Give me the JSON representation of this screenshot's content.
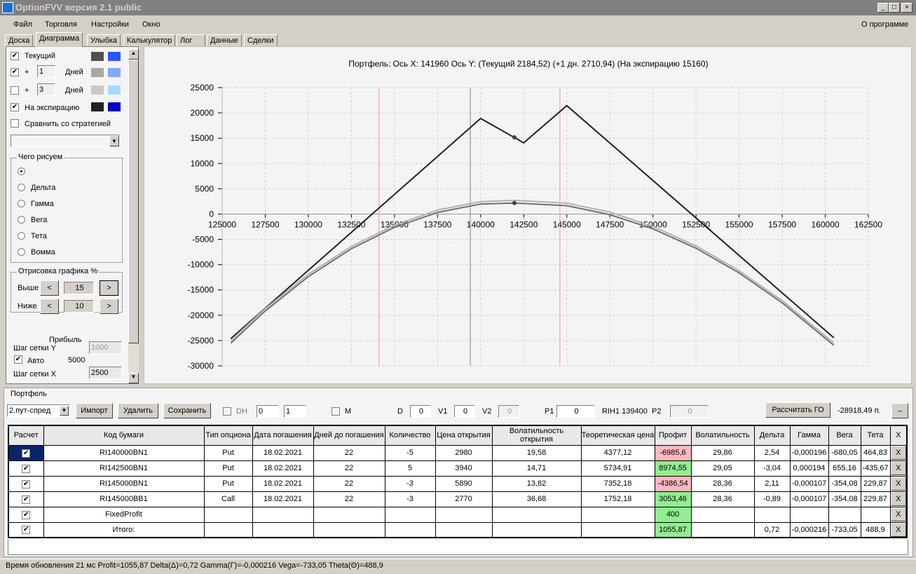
{
  "window": {
    "title": "OptionFVV версия 2.1 public",
    "minimize": "_",
    "maximize": "□",
    "close": "×"
  },
  "menu": [
    "Файл",
    "Торговля",
    "Настройки",
    "Окно"
  ],
  "about": "О программе",
  "tabs": [
    "Доска",
    "Диаграмма",
    "Улыбка",
    "Калькулятор",
    "Лог",
    "Данные",
    "Сделки"
  ],
  "left": {
    "current": "Текущий",
    "plus": "+",
    "days": "Дней",
    "days1": "1",
    "days3": "3",
    "expiration": "На экспирацию",
    "compare": "Сравнить со стратегией",
    "colors": {
      "cur": [
        "#505050",
        "#2a55ff"
      ],
      "d1": [
        "#a8a8a8",
        "#7faaff"
      ],
      "d3": [
        "#c8c8c8",
        "#aad8ff"
      ],
      "exp": [
        "#202020",
        "#0000c8"
      ]
    },
    "what_title": "Чего рисуем",
    "what": [
      "Прибыль",
      "Дельта",
      "Гамма",
      "Вега",
      "Тета",
      "Вомма"
    ],
    "draw_title": "Отрисовка графика %",
    "above": "Выше",
    "above_val": "15",
    "below": "Ниже",
    "below_val": "10",
    "lt": "<",
    "gt": ">",
    "grid_y": "Шаг сетки Y",
    "grid_y_val": "1000",
    "auto": "Авто",
    "auto_val": "5000",
    "grid_x": "Шаг сетки X",
    "grid_x_val": "2500"
  },
  "chart_data": {
    "type": "line",
    "title": "Портфель: Ось X: 141960 Ось Y:  (Текущий 2184,52)  (+1 дн. 2710,94)  (На экспирацию 15160)",
    "xlim": [
      125000,
      162500
    ],
    "ylim": [
      -30000,
      25000
    ],
    "xticks": [
      125000,
      127500,
      130000,
      132500,
      135000,
      137500,
      140000,
      142500,
      145000,
      147500,
      150000,
      152500,
      155000,
      157500,
      160000,
      162500
    ],
    "yticks": [
      25000,
      20000,
      15000,
      10000,
      5000,
      0,
      -5000,
      -10000,
      -15000,
      -20000,
      -25000,
      -30000
    ],
    "vlines": [
      {
        "x": 134100,
        "color": "#ff9090"
      },
      {
        "x": 139400,
        "color": "#808080"
      },
      {
        "x": 144600,
        "color": "#ff9090"
      }
    ],
    "series": [
      {
        "name": "На экспирацию",
        "color": "#202020",
        "x": [
          125500,
          140000,
          142500,
          145000,
          160500
        ],
        "y": [
          -24620,
          18900,
          14080,
          21440,
          -24460
        ]
      },
      {
        "name": "+1 дн.",
        "color": "#b0b0b0",
        "x": [
          125500,
          127500,
          130000,
          132500,
          135000,
          137500,
          140000,
          142000,
          145000,
          147500,
          150000,
          152500,
          155000,
          157500,
          160500
        ],
        "y": [
          -25000,
          -18700,
          -11900,
          -6400,
          -2200,
          800,
          2450,
          2710,
          2150,
          400,
          -2450,
          -6300,
          -11200,
          -17100,
          -25500
        ]
      },
      {
        "name": "Текущий",
        "color": "#707070",
        "x": [
          125500,
          127500,
          130000,
          132500,
          135000,
          137500,
          140000,
          142000,
          145000,
          147500,
          150000,
          152500,
          155000,
          157500,
          160500
        ],
        "y": [
          -25500,
          -19150,
          -12360,
          -6850,
          -2620,
          325,
          1990,
          2184,
          1650,
          -110,
          -2910,
          -6750,
          -11630,
          -17540,
          -25950
        ]
      }
    ],
    "markers": [
      {
        "x": 141960,
        "y": 15160
      },
      {
        "x": 141960,
        "y": 2184
      }
    ]
  },
  "portfolio": {
    "title": "Портфель",
    "strategy": "2.пут-спред",
    "import": "Импорт",
    "delete": "Удалить",
    "save": "Сохранить",
    "dh": "DH",
    "dh_a": "0",
    "dh_b": "1",
    "m": "M",
    "d": "D",
    "d_val": "0",
    "v1": "V1",
    "v1_val": "0",
    "v2": "V2",
    "v2_val": "0",
    "p1": "P1",
    "p1_val": "0",
    "rih": "RIH1 139400",
    "p2": "P2",
    "p2_val": "0",
    "calc_go": "Рассчитать ГО",
    "go_val": "-28918,49 п.",
    "min": "_",
    "headers": [
      "Расчет",
      "Код бумаги",
      "Тип опциона",
      "Дата погашения",
      "Дней до погашения",
      "Количество",
      "Цена открытия",
      "Волатильность открытия",
      "Теоретическая цена",
      "Профит",
      "Волатильность",
      "Дельта",
      "Гамма",
      "Вега",
      "Тета",
      "X"
    ],
    "rows": [
      {
        "code": "RI140000BN1",
        "type": "Put",
        "date": "18.02.2021",
        "days": "22",
        "qty": "-5",
        "open": "2980",
        "vol_open": "19,58",
        "theo": "4377,12",
        "profit": "-6985,6",
        "vol": "29,86",
        "delta": "2,54",
        "gamma": "-0,000196",
        "vega": "-680,05",
        "theta": "464,83",
        "sign": "neg"
      },
      {
        "code": "RI142500BN1",
        "type": "Put",
        "date": "18.02.2021",
        "days": "22",
        "qty": "5",
        "open": "3940",
        "vol_open": "14,71",
        "theo": "5734,91",
        "profit": "8974,55",
        "vol": "29,05",
        "delta": "-3,04",
        "gamma": "0,000194",
        "vega": "655,16",
        "theta": "-435,67",
        "sign": "pos"
      },
      {
        "code": "RI145000BN1",
        "type": "Put",
        "date": "18.02.2021",
        "days": "22",
        "qty": "-3",
        "open": "5890",
        "vol_open": "13,82",
        "theo": "7352,18",
        "profit": "-4386,54",
        "vol": "28,36",
        "delta": "2,11",
        "gamma": "-0,000107",
        "vega": "-354,08",
        "theta": "229,87",
        "sign": "neg"
      },
      {
        "code": "RI145000BB1",
        "type": "Call",
        "date": "18.02.2021",
        "days": "22",
        "qty": "-3",
        "open": "2770",
        "vol_open": "36,68",
        "theo": "1752,18",
        "profit": "3053,46",
        "vol": "28,36",
        "delta": "-0,89",
        "gamma": "-0,000107",
        "vega": "-354,08",
        "theta": "229,87",
        "sign": "pos"
      },
      {
        "code": "FixedProfit",
        "type": "",
        "date": "",
        "days": "",
        "qty": "",
        "open": "",
        "vol_open": "",
        "theo": "",
        "profit": "400",
        "vol": "",
        "delta": "",
        "gamma": "",
        "vega": "",
        "theta": "",
        "sign": "pos"
      },
      {
        "code": "Итого:",
        "type": "",
        "date": "",
        "days": "",
        "qty": "",
        "open": "",
        "vol_open": "",
        "theo": "",
        "profit": "1055,87",
        "vol": "",
        "delta": "0,72",
        "gamma": "-0,000216",
        "vega": "-733,05",
        "theta": "488,9",
        "sign": "pos"
      }
    ]
  },
  "status": "Время обновления 21 мс  Profit=1055,87 Delta(Δ)=0,72 Gamma(Γ)=-0,000216 Vega=-733,05 Theta(Θ)=488,9"
}
